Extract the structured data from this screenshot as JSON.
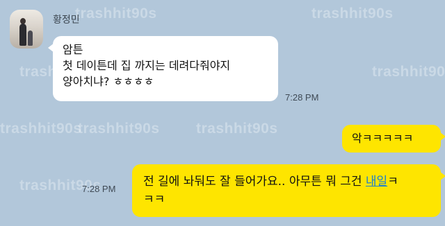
{
  "watermark": "trashhit90s",
  "chat": {
    "sender_name": "황정민",
    "incoming": {
      "lines": [
        "암튼",
        "첫 데이튼데 집 까지는 데려다줘야지",
        "양아치냐? ㅎㅎㅎㅎ"
      ],
      "time": "7:28 PM"
    },
    "outgoing": [
      {
        "text": "악ㅋㅋㅋㅋㅋ"
      },
      {
        "line1_prefix": "전 길에 놔둬도 잘 들어가요.. 아무튼 뭐 그건 ",
        "line1_link": "내일",
        "line1_suffix": "ㅋ",
        "line2": "ㅋㅋ",
        "time": "7:28 PM"
      }
    ]
  },
  "colors": {
    "background": "#b2c7da",
    "incoming_bubble": "#ffffff",
    "outgoing_bubble": "#fee500",
    "link": "#1a7fd0"
  },
  "icons": {
    "avatar": "profile-photo"
  }
}
